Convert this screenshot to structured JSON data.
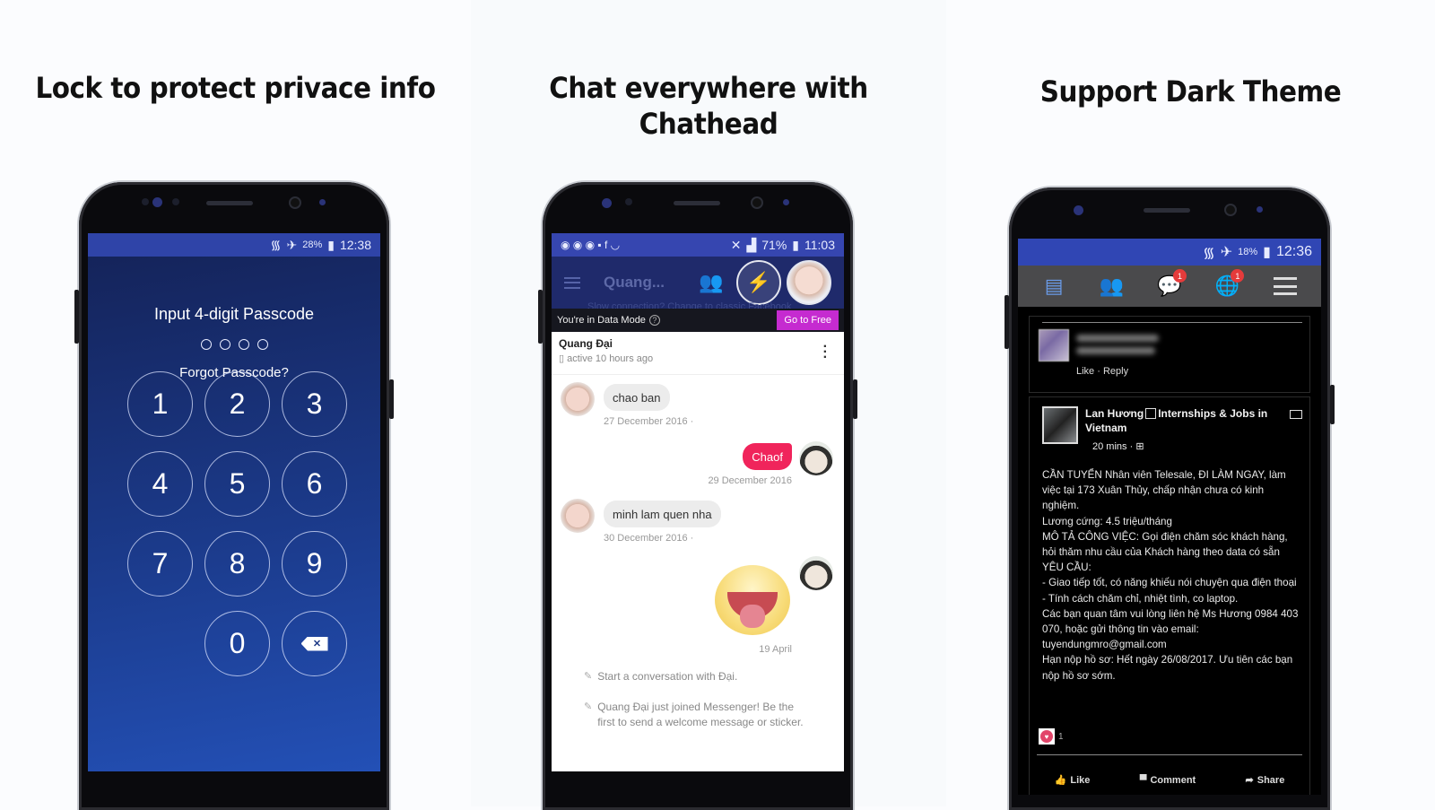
{
  "panels": [
    {
      "title": "Lock to protect privace info"
    },
    {
      "title": "Chat everywhere with Chathead"
    },
    {
      "title": "Support Dark Theme"
    }
  ],
  "lock_screen": {
    "status": {
      "battery": "28%",
      "time": "12:38"
    },
    "prompt": "Input 4-digit Passcode",
    "digits_entered": 0,
    "digits_total": 4,
    "forgot_label": "Forgot Passcode?",
    "keys": [
      "1",
      "2",
      "3",
      "4",
      "5",
      "6",
      "7",
      "8",
      "9",
      "",
      "0",
      "⌫"
    ],
    "backspace_glyph": "✕",
    "colors": {
      "status_bar": "#2f44a8",
      "bg_top": "#142257",
      "bg_bottom": "#2350b6"
    }
  },
  "chat_screen": {
    "status": {
      "battery": "71%",
      "time": "11:03",
      "left_icons": "◉ ◉ ◉ ▪ f ◡"
    },
    "toolbar_title": "Quang...",
    "slow_connection": "Slow connection? Change to classic Facebook",
    "data_mode": {
      "label": "You're in Data Mode",
      "help": "?",
      "button": "Go to Free"
    },
    "conversation": {
      "name": "Quang Đại",
      "active": "active 10 hours ago"
    },
    "messages": [
      {
        "direction": "in",
        "text": "chao ban",
        "time": "27 December 2016 ·"
      },
      {
        "direction": "out",
        "text": "Chaof",
        "time": "29 December 2016"
      },
      {
        "direction": "in",
        "text": "minh lam quen nha",
        "time": "30 December 2016 ·"
      },
      {
        "direction": "out",
        "sticker": "tongue-out-sticker",
        "time": "19 April"
      }
    ],
    "system_messages": [
      "Start a conversation with Đại.",
      "Quang Đại just joined Messenger! Be the first to send a welcome message or sticker."
    ],
    "colors": {
      "accent": "#f0245b",
      "go_free": "#c52bd0",
      "status_bar": "#3646b0"
    }
  },
  "dark_screen": {
    "status": {
      "battery": "18%",
      "time": "12:36"
    },
    "tabs": [
      {
        "icon": "news-feed-icon",
        "badge": ""
      },
      {
        "icon": "friends-icon",
        "badge": ""
      },
      {
        "icon": "messages-icon",
        "badge": "1"
      },
      {
        "icon": "notifications-globe-icon",
        "badge": "1"
      },
      {
        "icon": "menu-icon",
        "badge": ""
      }
    ],
    "comment": {
      "actions": "Like · Reply"
    },
    "post": {
      "author": "Lan Hương",
      "group": "Internships & Jobs in Vietnam",
      "time": "20 mins ·",
      "body": "CẦN TUYỂN Nhân viên Telesale, ĐI LÀM NGAY, làm việc tại 173 Xuân Thủy, chấp nhận chưa có kinh nghiệm.\nLương cứng: 4.5 triệu/tháng\nMÔ TẢ CÔNG VIỆC: Gọi điện chăm sóc khách hàng, hỏi thăm nhu cầu của Khách hàng theo data có sẵn\nYÊU CẦU:\n- Giao tiếp tốt, có năng khiếu nói chuyện qua điện thoại\n- Tính cách chăm chỉ, nhiệt tình, co laptop.\nCác bạn quan tâm vui lòng liên hệ Ms Hương 0984 403 070, hoặc gửi thông tin vào email: tuyendungmro@gmail.com\nHạn nộp hồ sơ: Hết ngày 26/08/2017. Ưu tiên các bạn nộp hồ sơ sớm.",
      "reaction_count": "1",
      "actions": {
        "like": "Like",
        "comment": "Comment",
        "share": "Share"
      }
    },
    "colors": {
      "tab_bar": "#4a4a4c",
      "active_tab": "#6a9be8",
      "badge": "#e53b3b"
    }
  }
}
